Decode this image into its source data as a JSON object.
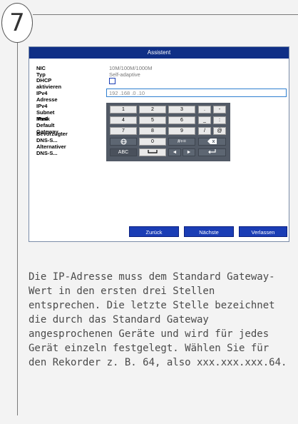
{
  "step_number": "7",
  "dialog": {
    "title": "Assistent",
    "fields": [
      {
        "label": "NIC Typ",
        "value": "10M/100M/1000M Self-adaptive"
      },
      {
        "label": "DHCP aktivieren",
        "value": ""
      },
      {
        "label": "IPv4 Adresse",
        "value": "192 .168 .0    .10"
      },
      {
        "label": "IPv4 Subnet Mask",
        "value": ""
      },
      {
        "label": "IPv4 Default Gateway",
        "value": ""
      },
      {
        "label": "Bevorzugter DNS-S...",
        "value": ""
      },
      {
        "label": "Alternativer DNS-S...",
        "value": ""
      }
    ],
    "keypad": {
      "row1": [
        "1",
        "2",
        "3",
        ".",
        "-"
      ],
      "row2": [
        "4",
        "5",
        "6",
        "_",
        ":"
      ],
      "row3": [
        "7",
        "8",
        "9",
        "/",
        "@"
      ],
      "row4": [
        "globe",
        "0",
        "#+=",
        "backspace"
      ],
      "row5": [
        "ABC",
        "space",
        "◄",
        "►",
        "enter"
      ]
    },
    "buttons": {
      "back": "Zurück",
      "next": "Nächste",
      "exit": "Verlassen"
    }
  },
  "caption": "Die IP-Adresse muss dem Standard Gateway-Wert in den ersten drei Stellen entsprechen. Die letzte Stelle bezeichnet die durch das Standard Gateway angesprochenen Geräte und wird für jedes Gerät einzeln festgelegt. Wählen Sie für den Rekorder z. B. 64, also xxx.xxx.xxx.64."
}
